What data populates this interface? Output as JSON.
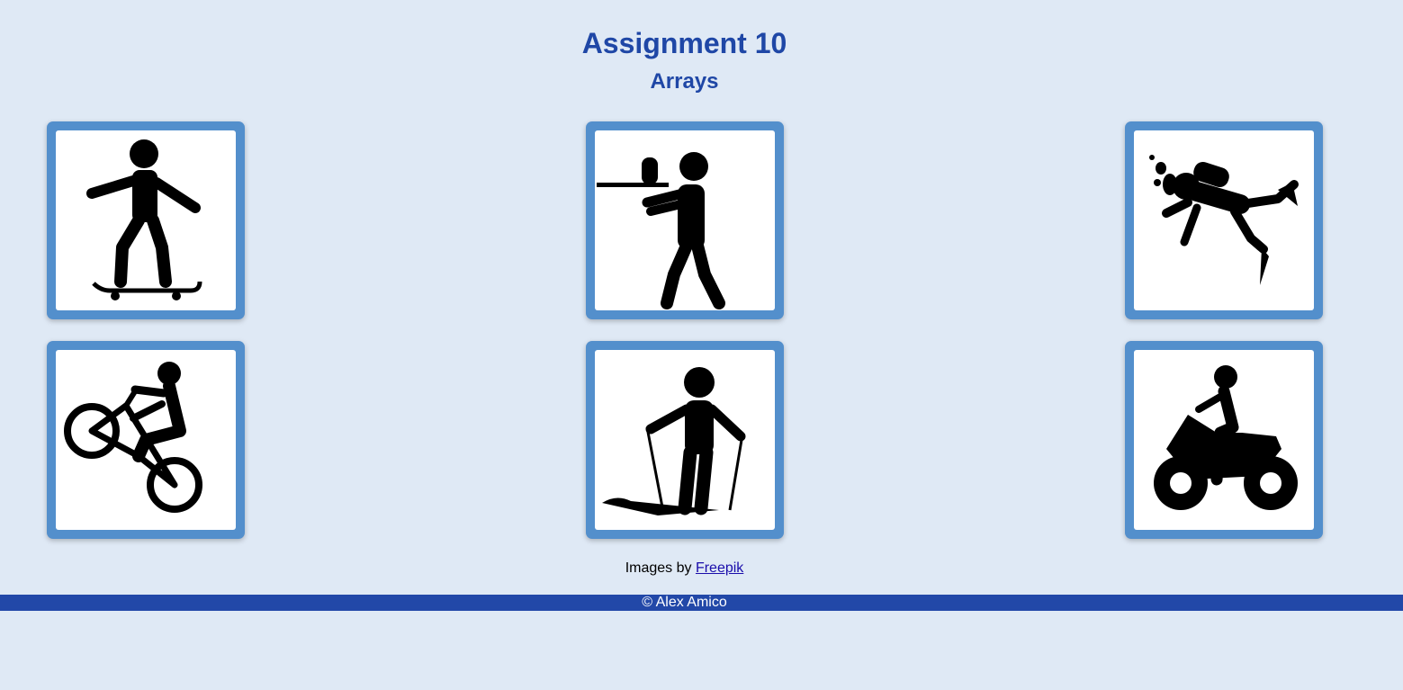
{
  "header": {
    "title": "Assignment 10",
    "subtitle": "Arrays"
  },
  "tiles": [
    {
      "icon": "skateboarder-icon"
    },
    {
      "icon": "paintball-player-icon"
    },
    {
      "icon": "scuba-diver-icon"
    },
    {
      "icon": "bmx-wheelie-icon"
    },
    {
      "icon": "skier-icon"
    },
    {
      "icon": "atv-rider-icon"
    }
  ],
  "credits": {
    "prefix": "Images by",
    "link_text": "Freepik"
  },
  "footer": {
    "text": "© Alex Amico"
  },
  "colors": {
    "background": "#dfe9f5",
    "heading": "#1f47a6",
    "tile_frame": "#538fcc",
    "footer_bar": "#2248a8"
  }
}
